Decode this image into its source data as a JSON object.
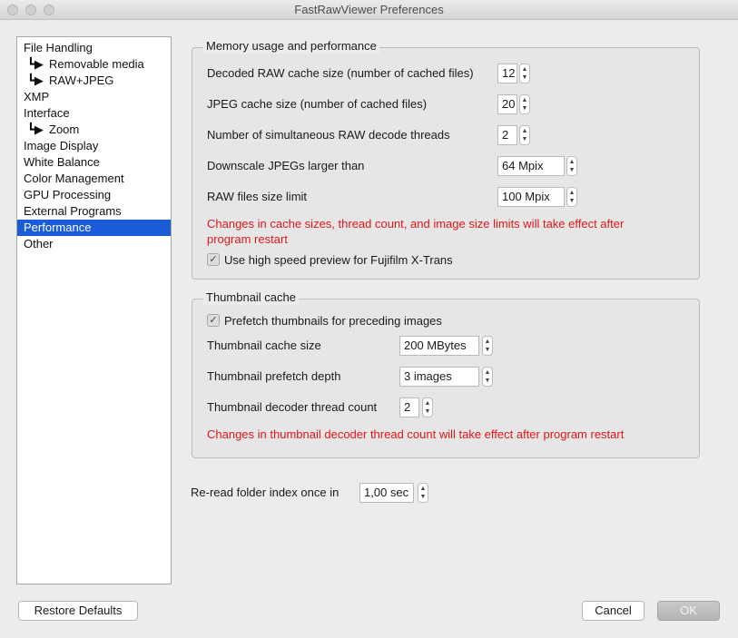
{
  "window": {
    "title": "FastRawViewer Preferences"
  },
  "sidebar": {
    "items": [
      {
        "label": "File Handling",
        "sub": false,
        "selected": false
      },
      {
        "label": "Removable media",
        "sub": true,
        "selected": false
      },
      {
        "label": "RAW+JPEG",
        "sub": true,
        "selected": false
      },
      {
        "label": "XMP",
        "sub": false,
        "selected": false
      },
      {
        "label": "Interface",
        "sub": false,
        "selected": false
      },
      {
        "label": "Zoom",
        "sub": true,
        "selected": false
      },
      {
        "label": "Image Display",
        "sub": false,
        "selected": false
      },
      {
        "label": "White Balance",
        "sub": false,
        "selected": false
      },
      {
        "label": "Color Management",
        "sub": false,
        "selected": false
      },
      {
        "label": "GPU Processing",
        "sub": false,
        "selected": false
      },
      {
        "label": "External Programs",
        "sub": false,
        "selected": false
      },
      {
        "label": "Performance",
        "sub": false,
        "selected": true
      },
      {
        "label": "Other",
        "sub": false,
        "selected": false
      }
    ],
    "sub_arrow_glyph": "┗▶"
  },
  "memory": {
    "title": "Memory usage and performance",
    "raw_cache_label": "Decoded RAW cache size (number of cached files)",
    "raw_cache_value": "12",
    "jpeg_cache_label": "JPEG cache size (number of cached files)",
    "jpeg_cache_value": "20",
    "threads_label": "Number of simultaneous RAW decode threads",
    "threads_value": "2",
    "downscale_label": "Downscale JPEGs larger than",
    "downscale_value": "64 Mpix",
    "raw_limit_label": "RAW files size limit",
    "raw_limit_value": "100 Mpix",
    "restart_note_line1": "Changes in cache sizes, thread count, and image size limits will take effect after",
    "restart_note_line2": "program restart",
    "xtrans_label": "Use high speed preview for Fujifilm X-Trans",
    "xtrans_checked": true
  },
  "thumbs": {
    "title": "Thumbnail cache",
    "prefetch_label": "Prefetch thumbnails for preceding images",
    "prefetch_checked": true,
    "cache_size_label": "Thumbnail cache size",
    "cache_size_value": "200 MBytes",
    "prefetch_depth_label": "Thumbnail prefetch depth",
    "prefetch_depth_value": "3 images",
    "decoder_threads_label": "Thumbnail decoder thread count",
    "decoder_threads_value": "2",
    "restart_note": "Changes in thumbnail decoder thread count will take effect after program restart"
  },
  "reread": {
    "label": "Re-read folder index once in",
    "value": "1,00 sec"
  },
  "buttons": {
    "restore": "Restore Defaults",
    "cancel": "Cancel",
    "ok": "OK"
  },
  "colors": {
    "selection": "#1a5bd7",
    "warning": "#e0161a"
  }
}
